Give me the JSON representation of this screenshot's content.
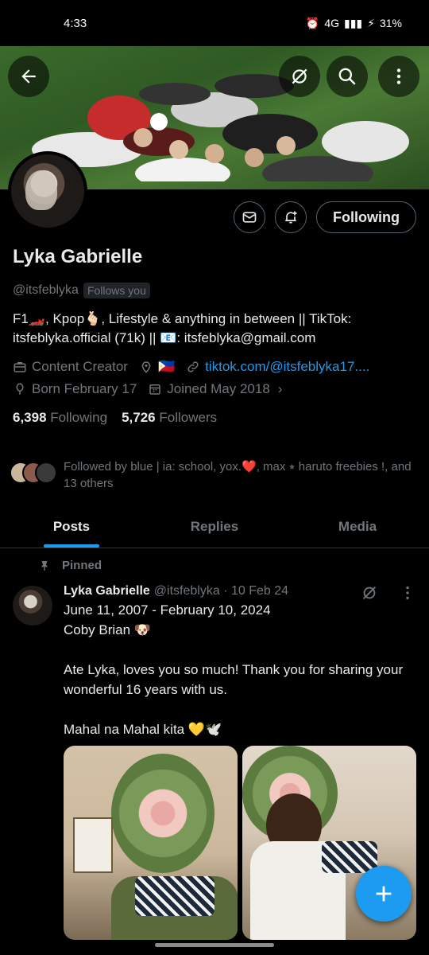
{
  "status": {
    "time": "4:33",
    "battery": "31%",
    "network": "4G"
  },
  "banner": {
    "back_icon": "arrow-left-icon",
    "grok_icon": "grok-icon",
    "search_icon": "search-icon",
    "more_icon": "more-vertical-icon"
  },
  "profile": {
    "name": "Lyka Gabrielle",
    "handle": "@itsfeblyka",
    "follows_you": "Follows you",
    "bio": "F1🏎️, Kpop🫰🏻, Lifestyle & anything in between || TikTok: itsfeblyka.official (71k) || 📧: itsfeblyka@gmail.com",
    "category": "Content Creator",
    "location_flag": "🇵🇭",
    "website": "tiktok.com/@itsfeblyka17....",
    "birthday": "Born February 17",
    "joined": "Joined May 2018",
    "following_count": "6,398",
    "following_label": "Following",
    "followers_count": "5,726",
    "followers_label": "Followers",
    "followed_by": "Followed by blue | ia: school, yox.❤️, max ⭒ haruto freebies !, and 13 others"
  },
  "actions": {
    "message_icon": "mail-icon",
    "notify_icon": "bell-plus-icon",
    "follow_label": "Following"
  },
  "tabs": [
    {
      "label": "Posts"
    },
    {
      "label": "Replies"
    },
    {
      "label": "Media"
    }
  ],
  "post": {
    "pinned_label": "Pinned",
    "name": "Lyka Gabrielle",
    "meta": "@itsfeblyka · 10 Feb 24",
    "text": "June 11, 2007 - February 10, 2024\nCoby Brian 🐶\n\nAte Lyka, loves you so much! Thank you for sharing your wonderful 16 years with us.\n\nMahal na Mahal kita 💛🕊️"
  },
  "fab": {
    "icon": "plus-icon"
  }
}
